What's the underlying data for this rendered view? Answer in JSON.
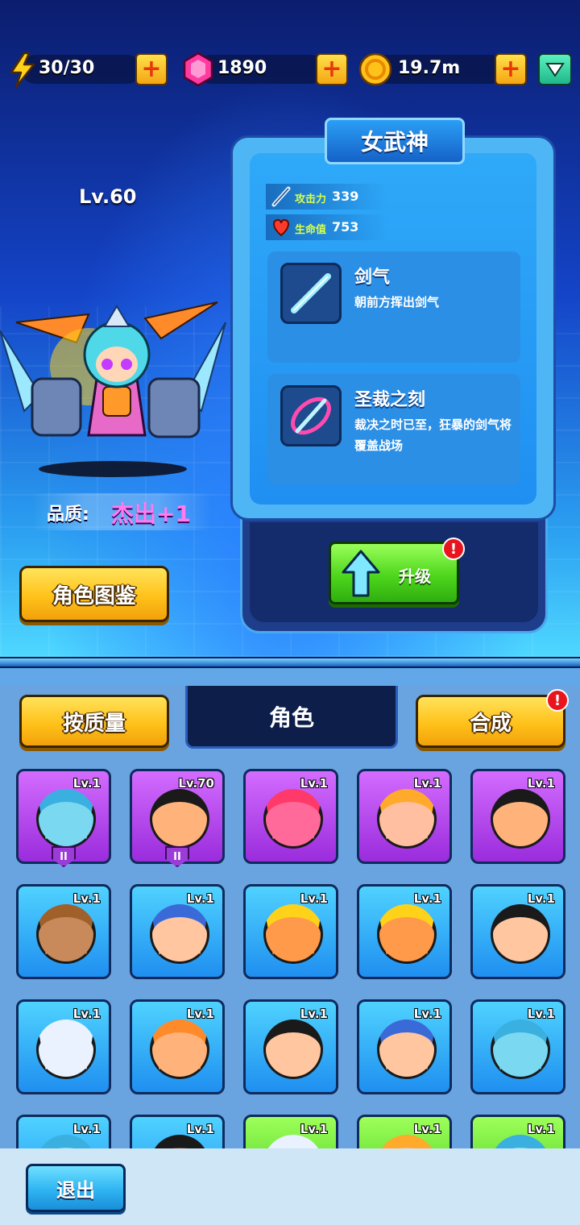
{
  "resources": {
    "energy": "30/30",
    "gems": "1890",
    "gold": "19.7m"
  },
  "hero": {
    "level": "Lv.60",
    "quality_label": "品质:",
    "quality_value": "杰出+1",
    "codex_button": "角色图鉴"
  },
  "panel": {
    "title": "女武神",
    "attack_label": "攻击力",
    "attack_value": "339",
    "hp_label": "生命值",
    "hp_value": "753",
    "skills": [
      {
        "name": "剑气",
        "desc": "朝前方挥出剑气"
      },
      {
        "name": "圣裁之刻",
        "desc": "裁决之时已至，狂暴的剑气将覆盖战场"
      }
    ],
    "upgrade_label": "升级",
    "alert": "!"
  },
  "roster": {
    "sort_button": "按质量",
    "tab_title": "角色",
    "merge_button": "合成",
    "merge_alert": "!",
    "cards": [
      {
        "lv": "Lv.1",
        "badge": "II"
      },
      {
        "lv": "Lv.70",
        "badge": "II"
      },
      {
        "lv": "Lv.1"
      },
      {
        "lv": "Lv.1"
      },
      {
        "lv": "Lv.1"
      },
      {
        "lv": "Lv.1"
      },
      {
        "lv": "Lv.1"
      },
      {
        "lv": "Lv.1"
      },
      {
        "lv": "Lv.1"
      },
      {
        "lv": "Lv.1"
      },
      {
        "lv": "Lv.1"
      },
      {
        "lv": "Lv.1"
      },
      {
        "lv": "Lv.1"
      },
      {
        "lv": "Lv.1"
      },
      {
        "lv": "Lv.1"
      },
      {
        "lv": "Lv.1"
      },
      {
        "lv": "Lv.1"
      },
      {
        "lv": "Lv.1"
      },
      {
        "lv": "Lv.1"
      },
      {
        "lv": "Lv.1"
      }
    ]
  },
  "footer": {
    "exit_button": "退出"
  },
  "icons": {
    "energy": "lightning-icon",
    "gems": "gem-icon",
    "gold": "coin-icon",
    "attack": "sword-icon",
    "hp": "heart-icon",
    "upgrade": "up-arrow-icon",
    "shop": "diamond-shop-icon"
  }
}
